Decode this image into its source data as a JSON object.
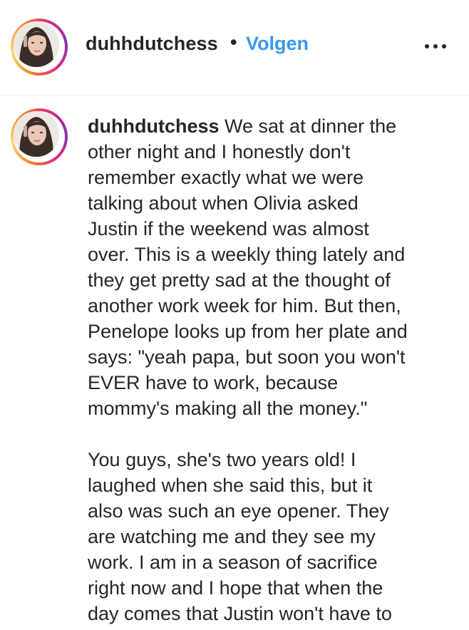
{
  "post_header": {
    "username": "duhhdutchess",
    "separator": "•",
    "follow_label": "Volgen",
    "more_icon": "more-horizontal-icon"
  },
  "caption": {
    "username": "duhhdutchess",
    "first_line_text": " We sat at dinner the",
    "lines": [
      "other night and I honestly don't",
      "remember exactly what we were",
      "talking about when Olivia asked",
      "Justin if the weekend was almost",
      "over. This is a weekly thing lately and",
      "they get pretty sad at the thought of",
      "another work week for him. But then,",
      "Penelope looks up from her plate and",
      "says: \"yeah papa, but soon you won't",
      "EVER have to work, because",
      "mommy's making all the money.\"",
      "",
      "You guys, she's two years old! I",
      "laughed when she said this, but it",
      "also was such an eye opener. They",
      "are watching me and they see my",
      "work. I am in a season of sacrifice",
      "right now and I hope that when the",
      "day comes that Justin won't have to"
    ]
  },
  "colors": {
    "text": "#262626",
    "follow_link": "#3897f0",
    "divider": "#efefef"
  }
}
